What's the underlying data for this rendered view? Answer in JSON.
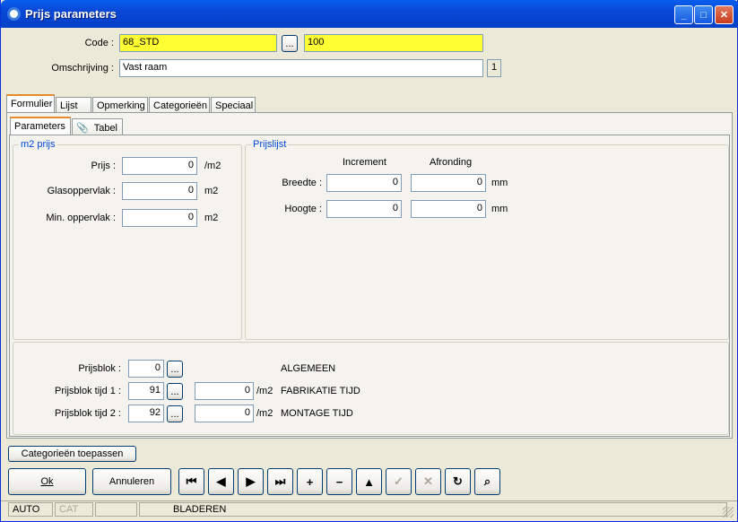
{
  "window": {
    "title": "Prijs parameters",
    "min": "_",
    "max": "□",
    "close": "✕"
  },
  "header": {
    "code_label": "Code :",
    "code_value": "68_STD",
    "code_btn": "...",
    "code_value2": "100",
    "desc_label": "Omschrijving :",
    "desc_value": "Vast raam",
    "desc_count": "1"
  },
  "tabs": [
    "Formulier",
    "Lijst",
    "Opmerking",
    "Categorieën",
    "Speciaal"
  ],
  "subtabs": {
    "parameters": "Parameters",
    "tabel": "Tabel"
  },
  "m2prijs": {
    "legend": "m2 prijs",
    "rows": [
      {
        "label": "Prijs :",
        "value": "0",
        "unit": "/m2"
      },
      {
        "label": "Glasoppervlak :",
        "value": "0",
        "unit": "m2"
      },
      {
        "label": "Min. oppervlak :",
        "value": "0",
        "unit": "m2"
      }
    ]
  },
  "prijslijst": {
    "legend": "Prijslijst",
    "col1": "Increment",
    "col2": "Afronding",
    "rows": [
      {
        "label": "Breedte :",
        "inc": "0",
        "afr": "0",
        "unit": "mm"
      },
      {
        "label": "Hoogte :",
        "inc": "0",
        "afr": "0",
        "unit": "mm"
      }
    ]
  },
  "prijsblok": {
    "rows": [
      {
        "label": "Prijsblok :",
        "value": "0",
        "btn": "...",
        "extra": "",
        "unit": "",
        "desc": "ALGEMEEN"
      },
      {
        "label": "Prijsblok tijd 1 :",
        "value": "91",
        "btn": "...",
        "extra": "0",
        "unit": "/m2",
        "desc": "FABRIKATIE TIJD"
      },
      {
        "label": "Prijsblok tijd 2 :",
        "value": "92",
        "btn": "...",
        "extra": "0",
        "unit": "/m2",
        "desc": "MONTAGE TIJD"
      }
    ]
  },
  "buttons": {
    "apply_categories": "Categorieën toepassen",
    "ok": "Ok",
    "cancel": "Annuleren"
  },
  "nav_icons": [
    "first-record-icon",
    "previous-record-icon",
    "next-record-icon",
    "last-record-icon",
    "add-record-icon",
    "delete-record-icon",
    "upload-icon",
    "confirm-icon",
    "discard-icon",
    "refresh-icon",
    "find-icon"
  ],
  "nav_glyphs": [
    "⏮",
    "◀",
    "▶",
    "⏭",
    "+",
    "−",
    "▲",
    "✓",
    "✕",
    "↻",
    "⌕"
  ],
  "statusbar": {
    "mode": "AUTO",
    "cat": "CAT",
    "empty": "",
    "state": "BLADEREN"
  }
}
